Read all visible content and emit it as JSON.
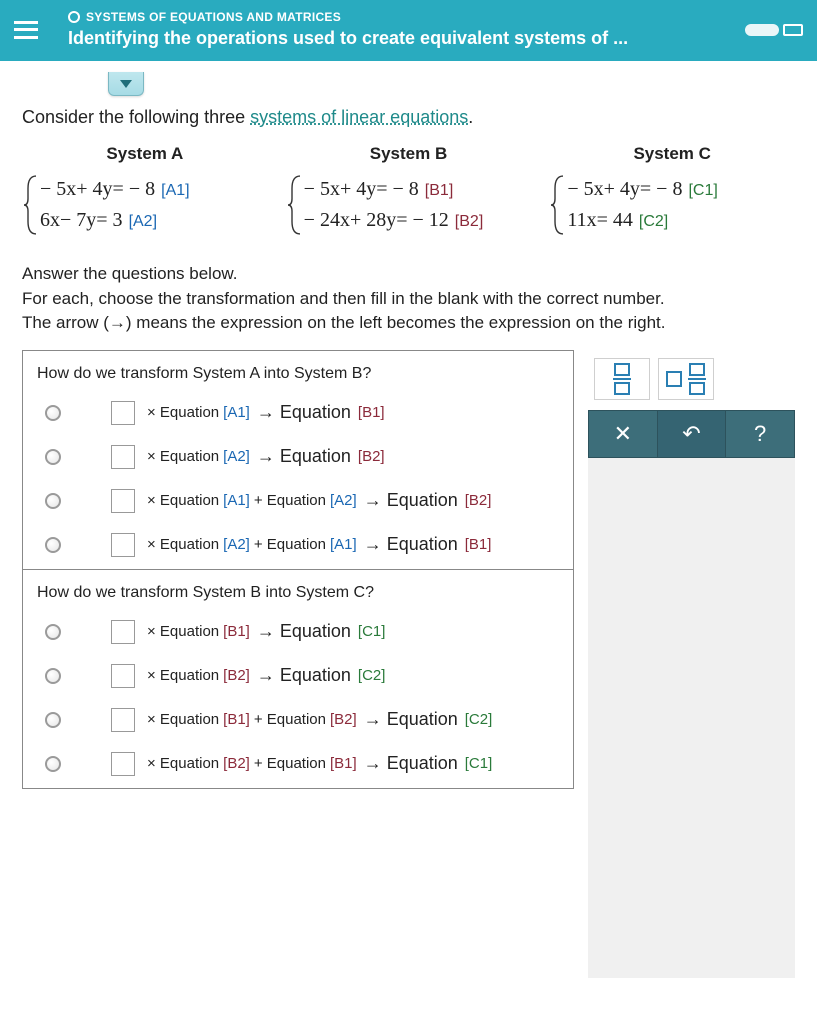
{
  "header": {
    "breadcrumb": "SYSTEMS OF EQUATIONS AND MATRICES",
    "title": "Identifying the operations used to create equivalent systems of ..."
  },
  "intro": {
    "prefix": "Consider the following three ",
    "link": "systems of linear equations",
    "suffix": "."
  },
  "systems": {
    "a": {
      "title": "System A",
      "eq1": "− 5x+ 4y= − 8",
      "label1": "[A1]",
      "eq2": "6x− 7y= 3",
      "label2": "[A2]"
    },
    "b": {
      "title": "System B",
      "eq1": "− 5x+ 4y= − 8",
      "label1": "[B1]",
      "eq2": "− 24x+ 28y= − 12",
      "label2": "[B2]"
    },
    "c": {
      "title": "System C",
      "eq1": "− 5x+ 4y= − 8",
      "label1": "[C1]",
      "eq2": "11x= 44",
      "label2": "[C2]"
    }
  },
  "answer_text": {
    "l1": "Answer the questions below.",
    "l2": "For each, choose the transformation and then fill in the blank with the correct number.",
    "l3_a": "The arrow ",
    "l3_arrow": "(→)",
    "l3_b": " means the expression on the left becomes the expression on the right."
  },
  "q1": {
    "title": "How do we transform System A into System B?",
    "opts": [
      {
        "pieces": [
          "× Equation ",
          "[A1]",
          " → Equation ",
          "[B1]"
        ],
        "cls": [
          "",
          "lab-blue",
          "",
          "lab-maroon"
        ]
      },
      {
        "pieces": [
          "× Equation ",
          "[A2]",
          " → Equation ",
          "[B2]"
        ],
        "cls": [
          "",
          "lab-blue",
          "",
          "lab-maroon"
        ]
      },
      {
        "pieces": [
          "× Equation ",
          "[A1]",
          " + Equation ",
          "[A2]",
          " → Equation ",
          "[B2]"
        ],
        "cls": [
          "",
          "lab-blue",
          "",
          "lab-blue",
          "",
          "lab-maroon"
        ]
      },
      {
        "pieces": [
          "× Equation ",
          "[A2]",
          " + Equation ",
          "[A1]",
          " → Equation ",
          "[B1]"
        ],
        "cls": [
          "",
          "lab-blue",
          "",
          "lab-blue",
          "",
          "lab-maroon"
        ]
      }
    ]
  },
  "q2": {
    "title": "How do we transform System B into System C?",
    "opts": [
      {
        "pieces": [
          "× Equation ",
          "[B1]",
          " → Equation ",
          "[C1]"
        ],
        "cls": [
          "",
          "lab-maroon",
          "",
          "lab-green"
        ]
      },
      {
        "pieces": [
          "× Equation ",
          "[B2]",
          " → Equation ",
          "[C2]"
        ],
        "cls": [
          "",
          "lab-maroon",
          "",
          "lab-green"
        ]
      },
      {
        "pieces": [
          "× Equation ",
          "[B1]",
          " + Equation ",
          "[B2]",
          " → Equation ",
          "[C2]"
        ],
        "cls": [
          "",
          "lab-maroon",
          "",
          "lab-maroon",
          "",
          "lab-green"
        ]
      },
      {
        "pieces": [
          "× Equation ",
          "[B2]",
          " + Equation ",
          "[B1]",
          " → Equation ",
          "[C1]"
        ],
        "cls": [
          "",
          "lab-maroon",
          "",
          "lab-maroon",
          "",
          "lab-green"
        ]
      }
    ]
  },
  "tools": {
    "clear": "✕",
    "undo": "↶",
    "help": "?"
  }
}
